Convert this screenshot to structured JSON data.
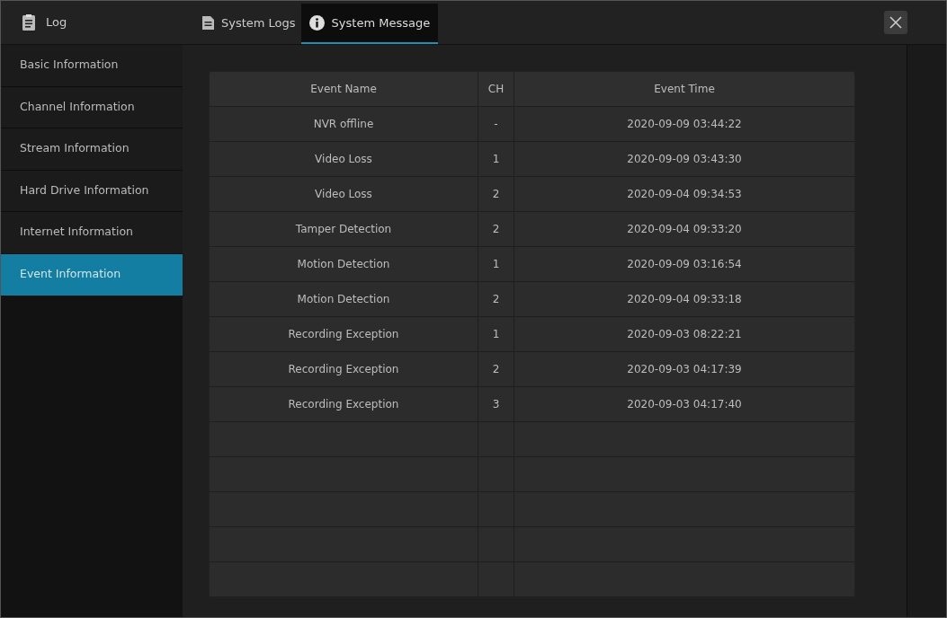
{
  "window": {
    "title": "Log"
  },
  "tabs": [
    {
      "label": "System Logs",
      "selected": false,
      "kind": "document"
    },
    {
      "label": "System Message",
      "selected": true,
      "kind": "info"
    }
  ],
  "sidebar": {
    "items": [
      {
        "label": "Basic Information",
        "selected": false
      },
      {
        "label": "Channel Information",
        "selected": false
      },
      {
        "label": "Stream Information",
        "selected": false
      },
      {
        "label": "Hard Drive Information",
        "selected": false
      },
      {
        "label": "Internet Information",
        "selected": false
      },
      {
        "label": "Event Information",
        "selected": true
      }
    ]
  },
  "table": {
    "columns": [
      "Event Name",
      "CH",
      "Event Time"
    ],
    "rows": [
      [
        "NVR offline",
        "-",
        "2020-09-09 03:44:22"
      ],
      [
        "Video Loss",
        "1",
        "2020-09-09 03:43:30"
      ],
      [
        "Video Loss",
        "2",
        "2020-09-04 09:34:53"
      ],
      [
        "Tamper Detection",
        "2",
        "2020-09-04 09:33:20"
      ],
      [
        "Motion Detection",
        "1",
        "2020-09-09 03:16:54"
      ],
      [
        "Motion Detection",
        "2",
        "2020-09-04 09:33:18"
      ],
      [
        "Recording Exception",
        "1",
        "2020-09-03 08:22:21"
      ],
      [
        "Recording Exception",
        "2",
        "2020-09-03 04:17:39"
      ],
      [
        "Recording Exception",
        "3",
        "2020-09-03 04:17:40"
      ]
    ]
  }
}
